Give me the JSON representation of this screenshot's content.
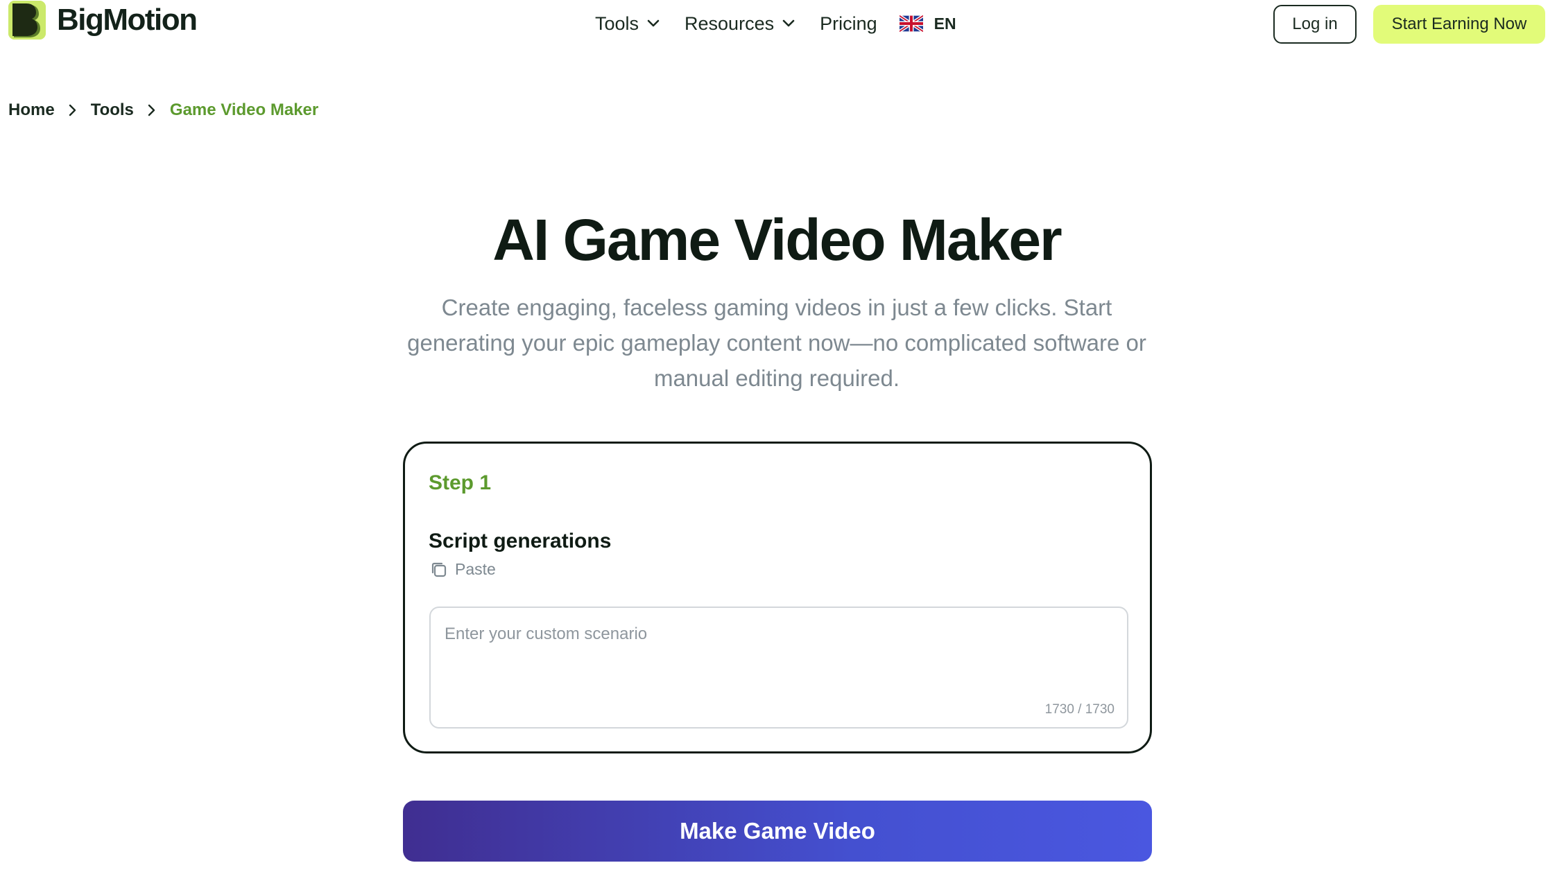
{
  "header": {
    "brand": "BigMotion",
    "nav": [
      {
        "label": "Tools",
        "has_dropdown": true
      },
      {
        "label": "Resources",
        "has_dropdown": true
      },
      {
        "label": "Pricing",
        "has_dropdown": false
      }
    ],
    "language": {
      "code": "EN",
      "flag_icon": "uk-flag-icon"
    },
    "login_label": "Log in",
    "cta_label": "Start Earning Now"
  },
  "breadcrumb": [
    {
      "label": "Home"
    },
    {
      "label": "Tools"
    },
    {
      "label": "Game Video Maker",
      "current": true
    }
  ],
  "hero": {
    "title": "AI Game Video Maker",
    "subtitle": "Create engaging, faceless gaming videos in just a few clicks. Start generating your epic gameplay content now—no complicated software or manual editing required."
  },
  "form": {
    "step_label": "Step 1",
    "section_label": "Script generations",
    "paste_label": "Paste",
    "scenario_value": "",
    "scenario_placeholder": "Enter your custom scenario",
    "char_counter": "1730 / 1730"
  },
  "submit_label": "Make Game Video",
  "colors": {
    "accent_green": "#5c9a2e",
    "cta_lime": "#e2fb79",
    "logo_lime": "#cbe96b",
    "submit_gradient_start": "#402e91",
    "submit_gradient_end": "#4a57e0"
  }
}
